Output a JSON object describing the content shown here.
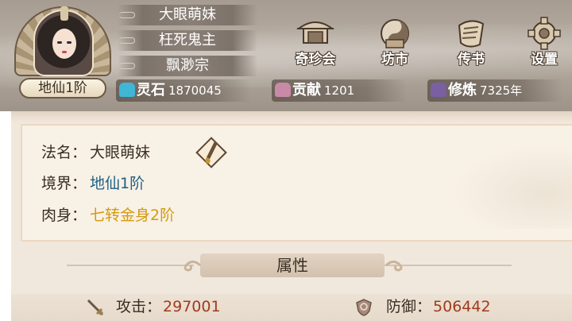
{
  "profile": {
    "name": "大眼萌妹",
    "title": "枉死鬼主",
    "sect": "飘渺宗",
    "realm_badge": "地仙1阶"
  },
  "menu": [
    {
      "label": "奇珍会",
      "icon": "treasure-pavilion-icon"
    },
    {
      "label": "坊市",
      "icon": "market-icon"
    },
    {
      "label": "传书",
      "icon": "scroll-letter-icon"
    },
    {
      "label": "设置",
      "icon": "gear-icon"
    }
  ],
  "resources": {
    "spirit_stone": {
      "label": "灵石",
      "value": "1870045",
      "icon": "spirit-stone-icon",
      "color": "#3fb6d6"
    },
    "contribution": {
      "label": "贡献",
      "value": "1201",
      "icon": "contribution-token-icon",
      "color": "#c98aa8"
    },
    "cultivation": {
      "label": "修炼",
      "value": "7325年",
      "icon": "meditation-figure-icon",
      "color": "#7a5fa3"
    }
  },
  "info": {
    "name_key": "法名：",
    "name_value": "大眼萌妹",
    "realm_key": "境界：",
    "realm_value": "地仙1阶",
    "body_key": "肉身：",
    "body_value": "七转金身2阶"
  },
  "attributes": {
    "section_title": "属性",
    "attack_key": "攻击：",
    "attack_value": "297001",
    "defense_key": "防御：",
    "defense_value": "506442"
  },
  "colors": {
    "realm_value": "#1f5f85",
    "body_value": "#d49a10",
    "stat_value": "#a03a1e"
  }
}
